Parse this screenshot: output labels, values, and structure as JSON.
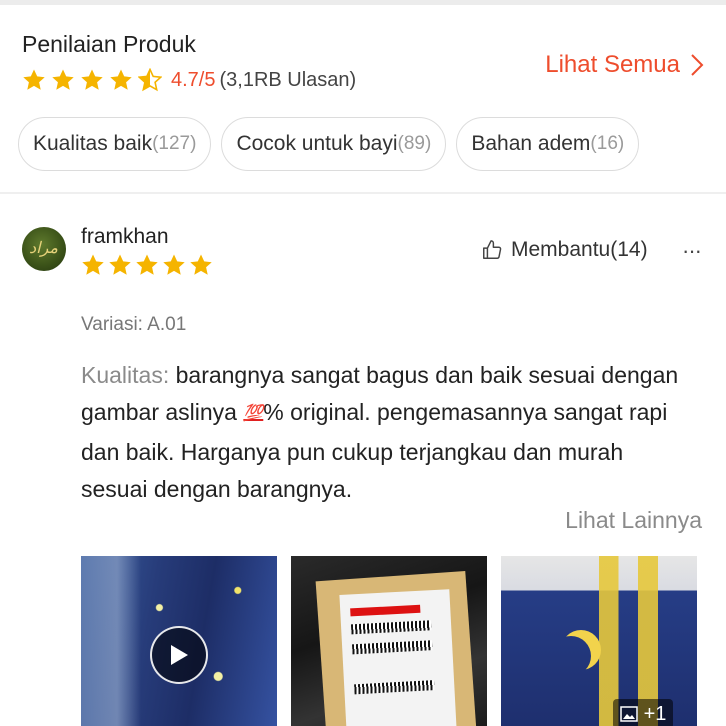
{
  "rating": {
    "title": "Penilaian Produk",
    "see_all": "Lihat Semua",
    "average": "4.7/5",
    "count": "(3,1RB Ulasan)",
    "stars": 4.7,
    "accent_color": "#ee4d2d",
    "star_color": "#f5b400"
  },
  "filters": [
    {
      "label": "Kualitas baik",
      "count": "(127)"
    },
    {
      "label": "Cocok untuk bayi",
      "count": "(89)"
    },
    {
      "label": "Bahan adem",
      "count": "(16)"
    }
  ],
  "review": {
    "username": "framkhan",
    "stars": 5,
    "helpful": "Membantu(14)",
    "more": "···",
    "variation": "Variasi: A.01",
    "quality_label": "Kualitas:",
    "text_part1": " barangnya sangat bagus dan baik sesuai dengan gambar aslinya ",
    "emoji": "💯",
    "text_part2": "% original. pengemasannya sangat rapi dan baik. Harganya pun cukup terjangkau dan murah sesuai dengan barangnya.",
    "see_more": "Lihat Lainnya",
    "extra_media": "+1"
  }
}
